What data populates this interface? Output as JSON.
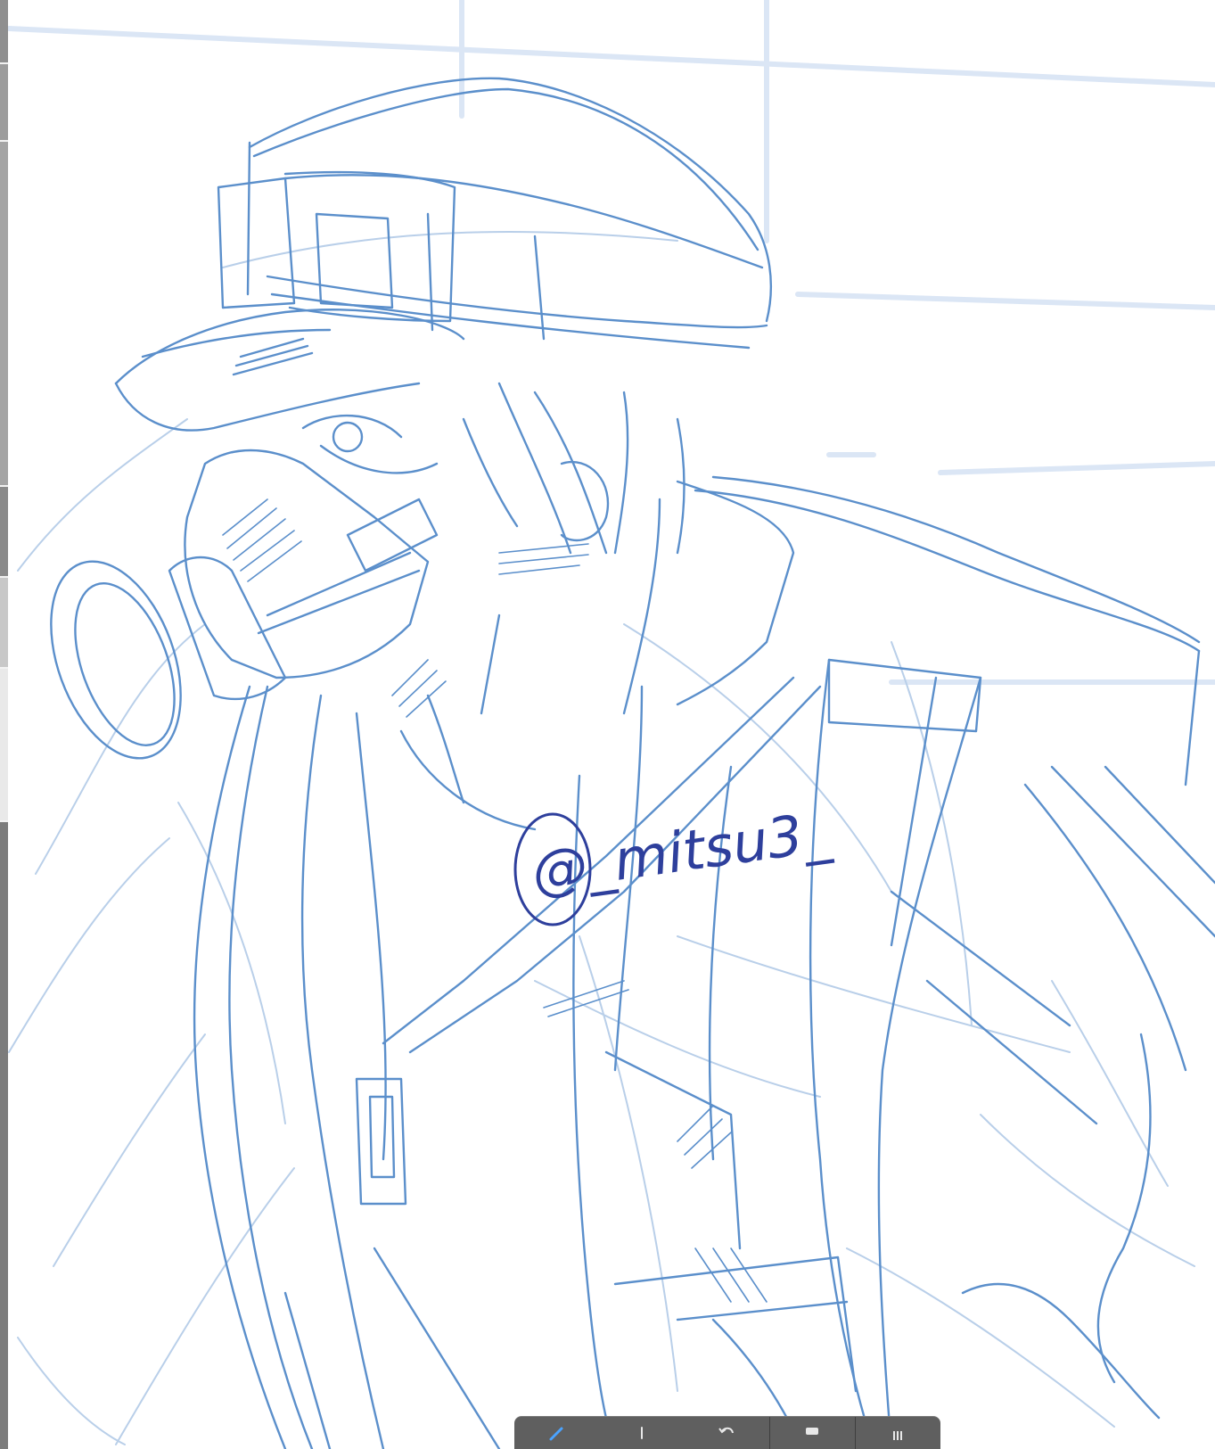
{
  "app": {
    "canvas": {
      "background_color": "#ffffff",
      "guide_color": "#dbe6f5",
      "rough_sketch_color": "#b9cfe9",
      "line_art_color": "#5b8fcb",
      "signature_color": "#2e3f9c",
      "signature_text": "@_mitsu3_"
    },
    "left_strip": {
      "colors": [
        "#9b9b9b",
        "#bdbdbd",
        "#7d7d7d",
        "#e6e6e6"
      ]
    },
    "toolbar": {
      "background_color": "#5f5f5f",
      "icons": [
        "brush-icon",
        "eyedropper-icon",
        "undo-icon",
        "layer-icon",
        "grid-icon"
      ]
    }
  }
}
